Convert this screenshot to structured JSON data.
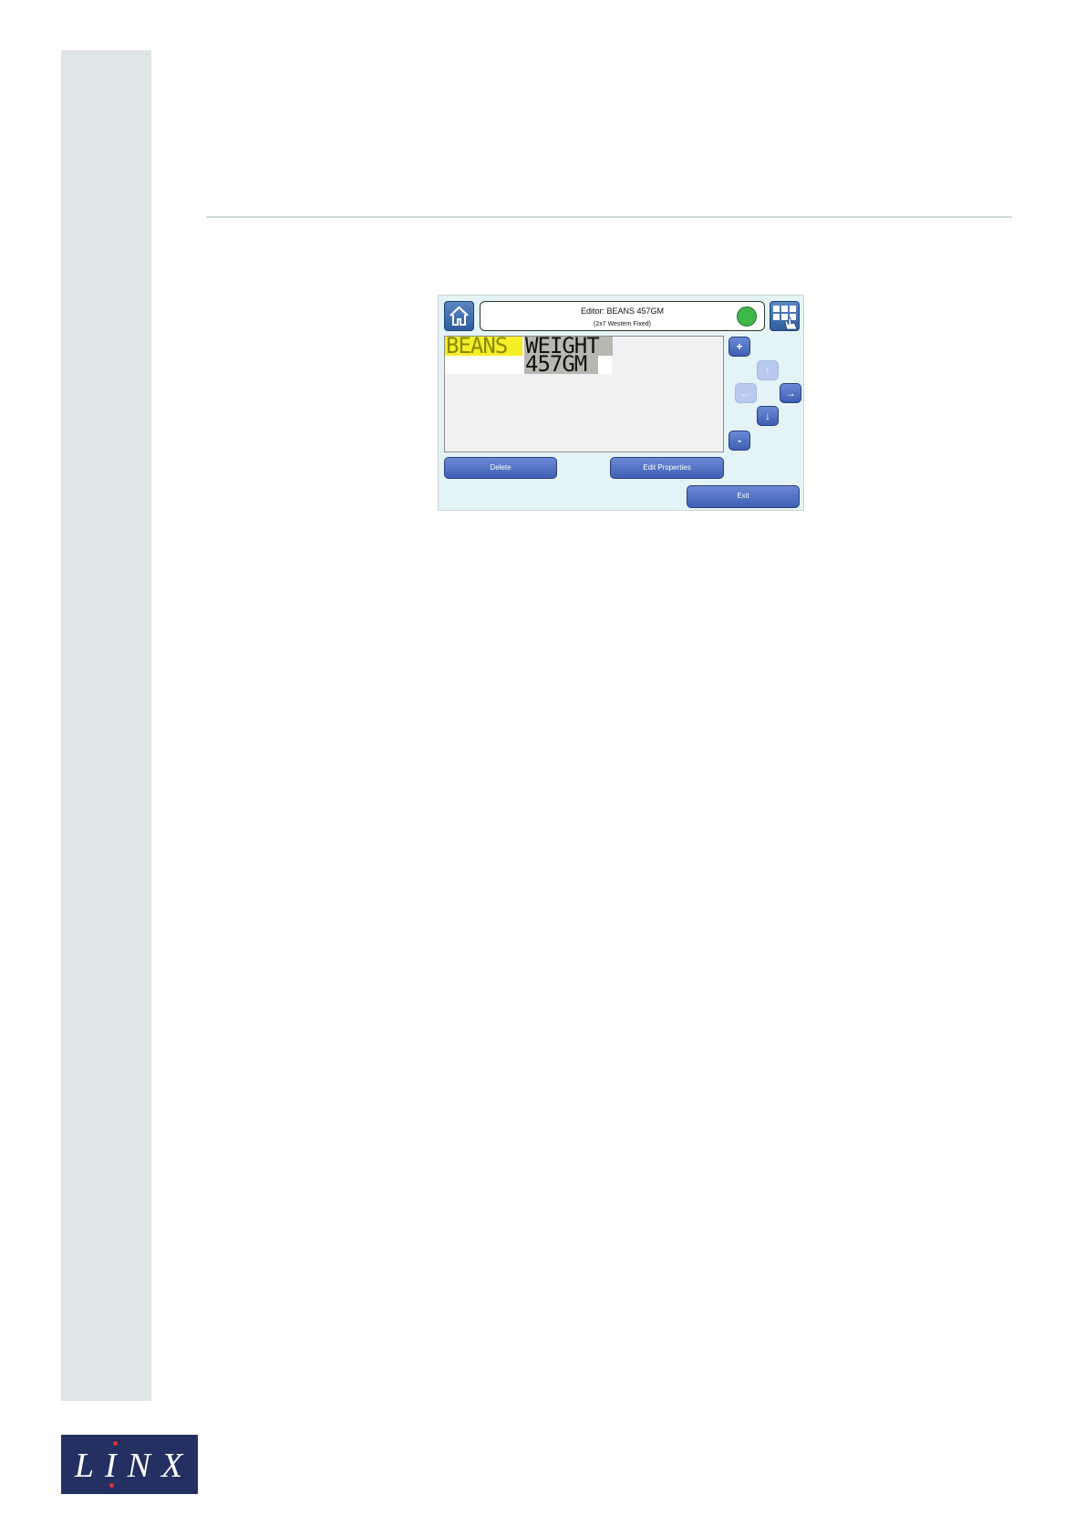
{
  "editor_screen": {
    "title": "Editor: BEANS 457GM",
    "subtitle": "(2x7 Western Fixed)",
    "status_color": "#3fb84a",
    "fields": [
      {
        "text": "BEANS",
        "selected": true
      },
      {
        "text": "WEIGHT",
        "selected": false
      },
      {
        "text": "457GM",
        "selected": false
      }
    ],
    "buttons": {
      "plus": "+",
      "minus": "-",
      "delete": "Delete",
      "edit_properties": "Edit Properties",
      "exit": "Exit"
    },
    "arrows": {
      "up": "↑",
      "down": "↓",
      "left": "←",
      "right": "→"
    }
  },
  "logo": {
    "text": "LINX",
    "accent_color": "#e0312f",
    "background": "#243061"
  }
}
